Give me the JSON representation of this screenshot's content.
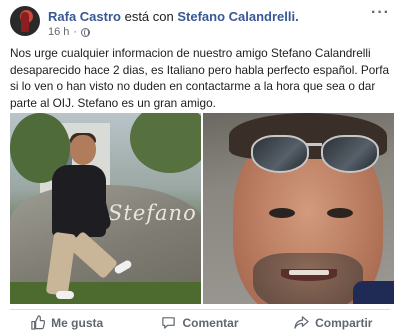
{
  "post": {
    "author": "Rafa Castro",
    "connector": "está con",
    "tagged": "Stefano Calandrelli.",
    "time": "16 h",
    "more_icon": "ellipsis-icon",
    "body": "Nos urge cualquier informacion de nuestro amigo Stefano Calandrelli desaparecido hace 2 dias, es Italiano pero habla perfecto español. Porfa si lo ven o han visto no duden en contactarme a la hora que sea o dar parte al OIJ. Stefano es un gran amigo.",
    "photo_left_sign": "Stefano"
  },
  "actions": {
    "like": "Me gusta",
    "comment": "Comentar",
    "share": "Compartir"
  },
  "colors": {
    "link": "#385898",
    "muted": "#606770"
  }
}
